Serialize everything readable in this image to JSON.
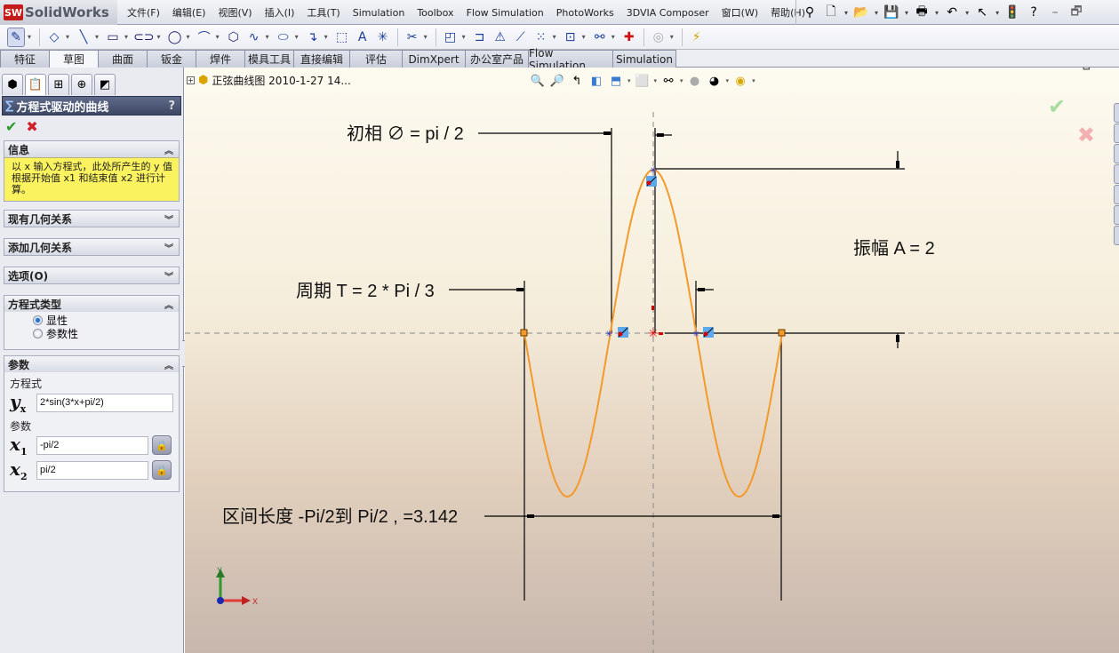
{
  "app": {
    "logo_badge": "SW",
    "name": "SolidWorks"
  },
  "menus": [
    "文件(F)",
    "编辑(E)",
    "视图(V)",
    "插入(I)",
    "工具(T)",
    "Simulation",
    "Toolbox",
    "Flow Simulation",
    "PhotoWorks",
    "3DVIA Composer",
    "窗口(W)",
    "帮助(H)"
  ],
  "quick_tools": [
    {
      "icon": "pushpin-icon",
      "glyph": "⚲"
    },
    {
      "icon": "new-document-icon",
      "glyph": "🗋"
    },
    {
      "icon": "open-folder-icon",
      "glyph": "📂"
    },
    {
      "icon": "save-icon",
      "glyph": "💾"
    },
    {
      "icon": "print-icon",
      "glyph": "🖶"
    },
    {
      "icon": "undo-icon",
      "glyph": "↶"
    },
    {
      "icon": "select-arrow-icon",
      "glyph": "↖"
    },
    {
      "icon": "rebuild-traffic-light-icon",
      "glyph": "🚦"
    },
    {
      "icon": "help-icon",
      "glyph": "?"
    }
  ],
  "app_window_controls": [
    "–",
    "🗗"
  ],
  "sketch_tools": [
    {
      "icon": "sketch-icon",
      "glyph": "✎",
      "active": true
    },
    {
      "icon": "smart-dimension-icon",
      "glyph": "◇"
    },
    {
      "icon": "line-icon",
      "glyph": "╲"
    },
    {
      "icon": "rectangle-icon",
      "glyph": "▭"
    },
    {
      "icon": "slot-icon",
      "glyph": "⊂⊃"
    },
    {
      "icon": "circle-icon",
      "glyph": "◯"
    },
    {
      "icon": "arc-icon",
      "glyph": "⌒"
    },
    {
      "icon": "polygon-icon",
      "glyph": "⬡"
    },
    {
      "icon": "spline-icon",
      "glyph": "∿"
    },
    {
      "icon": "ellipse-icon",
      "glyph": "⬭"
    },
    {
      "icon": "fillet-icon",
      "glyph": "↴"
    },
    {
      "icon": "plane-icon",
      "glyph": "⬚"
    },
    {
      "icon": "text-icon",
      "glyph": "A"
    },
    {
      "icon": "point-icon",
      "glyph": "✳"
    },
    {
      "icon": "trim-icon",
      "glyph": "✂"
    },
    {
      "icon": "convert-entities-icon",
      "glyph": "◰"
    },
    {
      "icon": "offset-icon",
      "glyph": "⊐"
    },
    {
      "icon": "mirror-icon",
      "glyph": "⚠"
    },
    {
      "icon": "move-entities-icon",
      "glyph": "⟋"
    },
    {
      "icon": "linear-pattern-icon",
      "glyph": "⁙"
    },
    {
      "icon": "display-relations-icon",
      "glyph": "⊡"
    },
    {
      "icon": "repair-sketch-icon",
      "glyph": "⚯"
    },
    {
      "icon": "quick-snaps-icon",
      "glyph": "✚"
    },
    {
      "icon": "rapid-sketch-icon",
      "glyph": "◎"
    },
    {
      "icon": "instant3d-icon",
      "glyph": "⚡"
    }
  ],
  "command_tabs": [
    {
      "label": "特征",
      "selected": false
    },
    {
      "label": "草图",
      "selected": true
    },
    {
      "label": "曲面",
      "selected": false
    },
    {
      "label": "钣金",
      "selected": false
    },
    {
      "label": "焊件",
      "selected": false
    },
    {
      "label": "模具工具",
      "selected": false
    },
    {
      "label": "直接编辑",
      "selected": false
    },
    {
      "label": "评估",
      "selected": false
    },
    {
      "label": "DimXpert",
      "selected": false
    },
    {
      "label": "办公室产品",
      "selected": false
    },
    {
      "label": "Flow Simulation",
      "selected": false
    },
    {
      "label": "Simulation",
      "selected": false
    }
  ],
  "panel_tabs": [
    {
      "icon": "feature-manager-icon",
      "glyph": "⬢"
    },
    {
      "icon": "property-manager-icon",
      "glyph": "📋",
      "selected": true
    },
    {
      "icon": "configuration-manager-icon",
      "glyph": "⊞"
    },
    {
      "icon": "dimxpert-manager-icon",
      "glyph": "⊕"
    },
    {
      "icon": "display-manager-icon",
      "glyph": "◩"
    }
  ],
  "property_manager": {
    "title": "方程式驱动的曲线",
    "help": "?",
    "ok_glyph": "✔",
    "cancel_glyph": "✖",
    "sections": {
      "info": {
        "title": "信息",
        "text": "以 x 输入方程式，此处所产生的 y 值根据开始值 x1 和结束值 x2 进行计算。"
      },
      "existing_relations": {
        "title": "现有几何关系"
      },
      "add_relations": {
        "title": "添加几何关系"
      },
      "options": {
        "title": "选项(O)"
      },
      "equation_type": {
        "title": "方程式类型",
        "options": [
          {
            "label": "显性",
            "checked": true
          },
          {
            "label": "参数性",
            "checked": false
          }
        ]
      },
      "parameters": {
        "title": "参数",
        "equation_label": "方程式",
        "y_symbol": "y",
        "y_sub": "x",
        "equation_value": "2*sin(3*x+pi/2)",
        "params_label": "参数",
        "x1_symbol": "x",
        "x1_sub": "1",
        "x1_value": "-pi/2",
        "x2_symbol": "x",
        "x2_sub": "2",
        "x2_value": "pi/2"
      }
    }
  },
  "viewport": {
    "tree_item": "正弦曲线图 2010-1-27 14...",
    "headsup_tools": [
      {
        "icon": "zoom-to-fit-icon",
        "glyph": "🔍"
      },
      {
        "icon": "zoom-to-area-icon",
        "glyph": "🔎"
      },
      {
        "icon": "previous-view-icon",
        "glyph": "↰"
      },
      {
        "icon": "section-view-icon",
        "glyph": "◧"
      },
      {
        "icon": "view-orientation-icon",
        "glyph": "⬒"
      },
      {
        "icon": "display-style-icon",
        "glyph": "⬜"
      },
      {
        "icon": "hide-show-items-icon",
        "glyph": "⚯"
      },
      {
        "icon": "edit-appearance-icon",
        "glyph": "●"
      },
      {
        "icon": "apply-scene-icon",
        "glyph": "◕"
      },
      {
        "icon": "view-settings-icon",
        "glyph": "◉"
      }
    ],
    "doc_window_controls": [
      "–",
      "🗗",
      "✕"
    ],
    "confirm_ok": "✔",
    "confirm_cancel": "✖",
    "annotations": {
      "phase": "初相 ∅ = pi / 2",
      "period": "周期 T = 2 * Pi / 3",
      "amplitude": "振幅 A = 2",
      "interval": "区间长度 -Pi/2到 Pi/2  , =3.142"
    },
    "curve": {
      "amplitude": 2,
      "frequency": 3,
      "phase": 1.5708,
      "x_start": -1.5708,
      "x_end": 1.5708,
      "color": "#f39a2c"
    },
    "triad": {
      "x": "X",
      "y": "Y"
    }
  }
}
